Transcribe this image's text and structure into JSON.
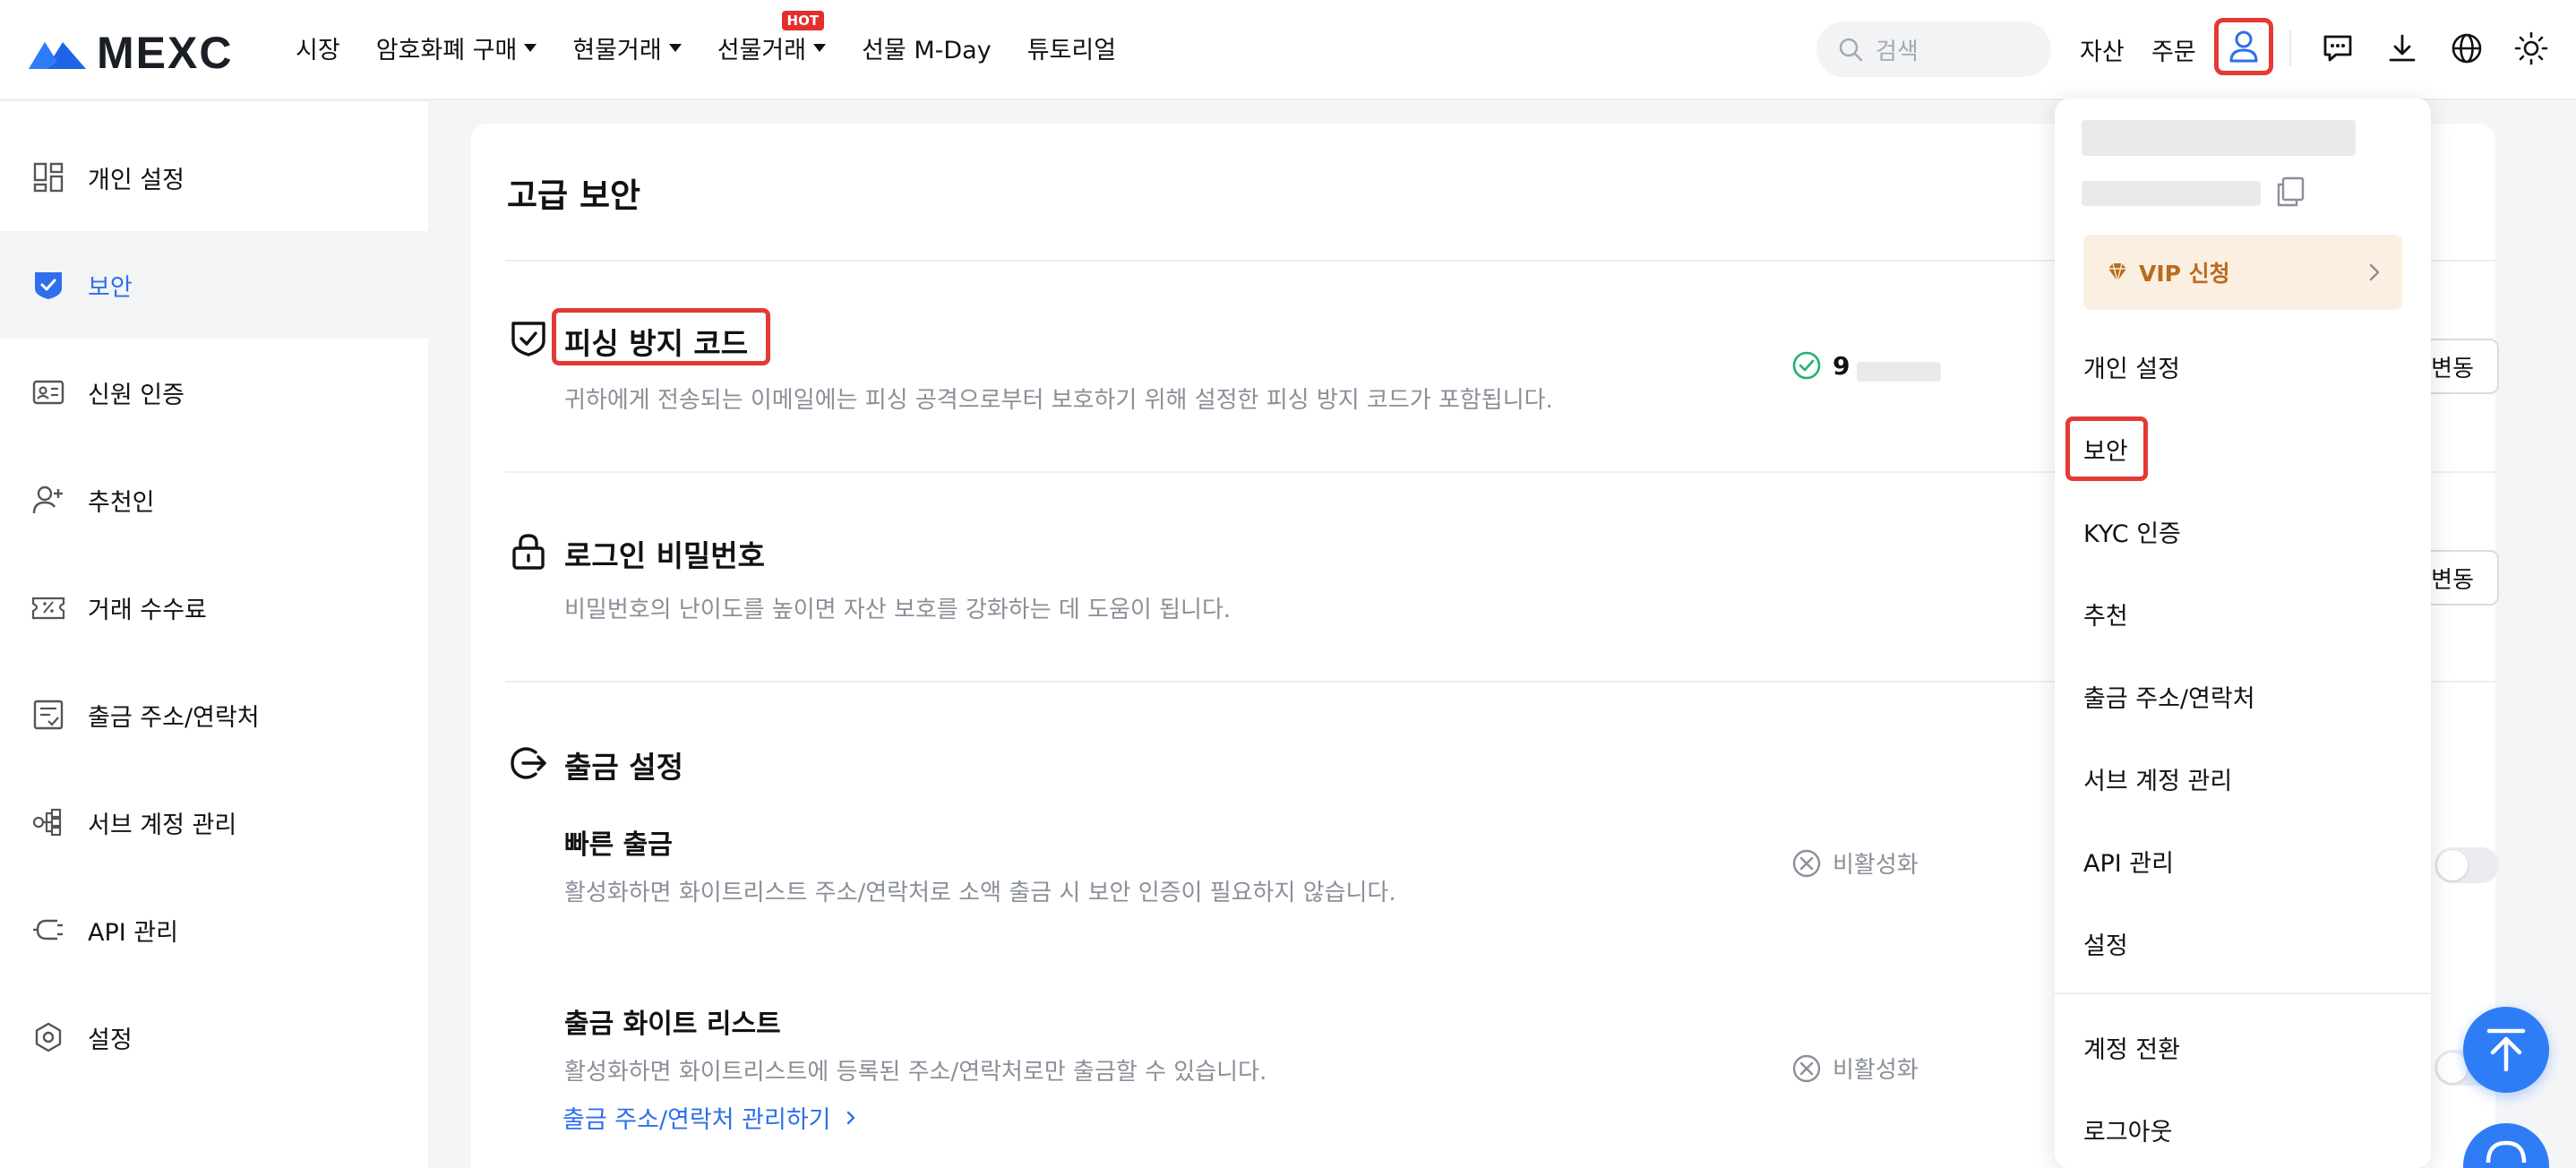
{
  "brand": {
    "name": "MEXC",
    "accent": "#2f6fea",
    "highlight": "#e53935"
  },
  "nav": {
    "items": [
      {
        "label": "시장"
      },
      {
        "label": "암호화폐 구매"
      },
      {
        "label": "현물거래"
      },
      {
        "label": "선물거래",
        "badge": "HOT"
      },
      {
        "label": "선물 M-Day"
      },
      {
        "label": "튜토리얼"
      }
    ]
  },
  "search": {
    "placeholder": "검색"
  },
  "top_right": {
    "assets": "자산",
    "orders": "주문"
  },
  "sidebar": {
    "items": [
      {
        "label": "개인 설정",
        "icon": "personal-settings-icon"
      },
      {
        "label": "보안",
        "icon": "shield-icon",
        "active": true
      },
      {
        "label": "신원 인증",
        "icon": "id-card-icon"
      },
      {
        "label": "추천인",
        "icon": "add-user-icon"
      },
      {
        "label": "거래 수수료",
        "icon": "ticket-icon"
      },
      {
        "label": "출금 주소/연락처",
        "icon": "address-book-icon"
      },
      {
        "label": "서브 계정 관리",
        "icon": "sub-account-icon"
      },
      {
        "label": "API 관리",
        "icon": "api-plug-icon"
      },
      {
        "label": "설정",
        "icon": "settings-hexagon-icon"
      }
    ]
  },
  "main": {
    "title": "고급 보안",
    "phishing": {
      "title": "피싱 방지 코드",
      "desc": "귀하에게 전송되는 이메일에는 피싱 공격으로부터 보호하기 위해 설정한 피싱 방지 코드가 포함됩니다.",
      "value_visible": "9",
      "button": "변동"
    },
    "password": {
      "title": "로그인 비밀번호",
      "desc": "비밀번호의 난이도를 높이면 자산 보호를 강화하는 데 도움이 됩니다.",
      "button": "변동"
    },
    "withdraw": {
      "title": "출금 설정",
      "fast": {
        "title": "빠른 출금",
        "desc": "활성화하면 화이트리스트 주소/연락처로 소액 출금 시 보안 인증이 필요하지 않습니다.",
        "status": "비활성화"
      },
      "whitelist": {
        "title": "출금 화이트 리스트",
        "desc": "활성화하면 화이트리스트에 등록된 주소/연락처로만 출금할 수 있습니다.",
        "status": "비활성화",
        "link": "출금 주소/연락처 관리하기"
      }
    }
  },
  "dropdown": {
    "vip": "VIP 신청",
    "items": [
      {
        "label": "개인 설정"
      },
      {
        "label": "보안",
        "highlighted": true
      },
      {
        "label": "KYC 인증"
      },
      {
        "label": "추천"
      },
      {
        "label": "출금 주소/연락처"
      },
      {
        "label": "서브 계정 관리"
      },
      {
        "label": "API 관리"
      },
      {
        "label": "설정"
      }
    ],
    "footer_items": [
      {
        "label": "계정 전환"
      },
      {
        "label": "로그아웃"
      }
    ]
  }
}
